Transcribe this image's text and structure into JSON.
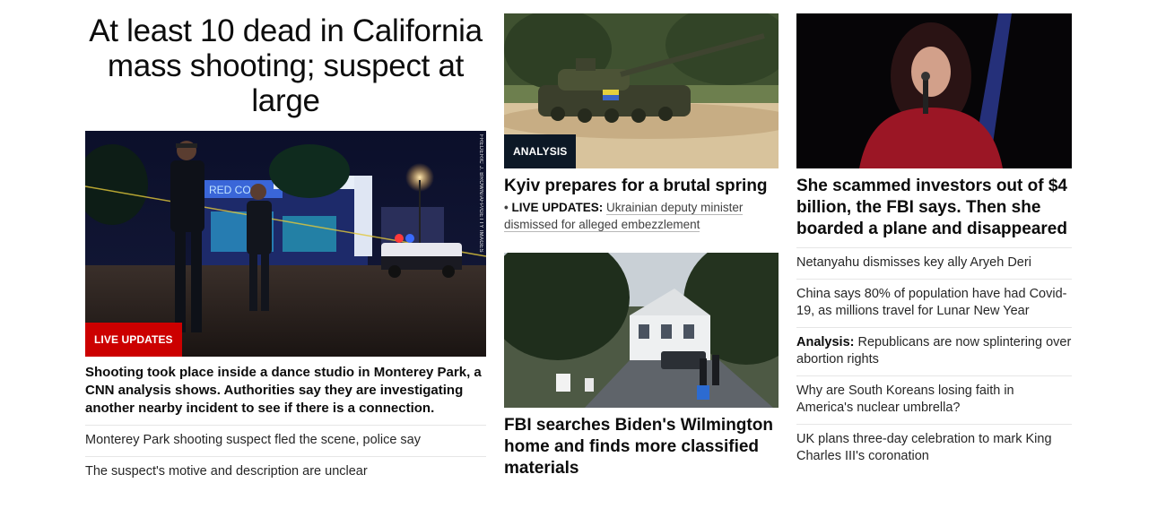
{
  "lead": {
    "headline": "At least 10 dead in California mass shooting; suspect at large",
    "image_badge": "LIVE UPDATES",
    "image_credit": "FREDERIC J. BROWN/AFP/GETTY IMAGES",
    "image_sign_text": "RED CO",
    "summary": "Shooting took place inside a dance studio in Monterey Park, a CNN analysis shows. Authorities say they are investigating another nearby incident to see if there is a connection.",
    "links": [
      "Monterey Park shooting suspect fled the scene, police say",
      "The suspect's motive and description are unclear"
    ]
  },
  "kyiv": {
    "badge": "ANALYSIS",
    "title": "Kyiv prepares for a brutal spring",
    "sub_label": "LIVE UPDATES:",
    "sub_text": "Ukrainian deputy minister dismissed for alleged embezzlement",
    "bullet": "•"
  },
  "biden": {
    "title": "FBI searches Biden's Wilmington home and finds more classified materials"
  },
  "scam": {
    "title": "She scammed investors out of $4 billion, the FBI says. Then she boarded a plane and disappeared"
  },
  "right_links": [
    {
      "label": "",
      "text": "Netanyahu dismisses key ally Aryeh Deri"
    },
    {
      "label": "",
      "text": "China says 80% of population have had Covid-19, as millions travel for Lunar New Year"
    },
    {
      "label": "Analysis:",
      "text": "Republicans are now splintering over abortion rights"
    },
    {
      "label": "",
      "text": "Why are South Koreans losing faith in America's nuclear umbrella?"
    },
    {
      "label": "",
      "text": "UK plans three-day celebration to mark King Charles III's coronation"
    }
  ],
  "colors": {
    "live_red": "#cc0000",
    "analysis_navy": "#0c1826",
    "text": "#0c0c0c"
  }
}
